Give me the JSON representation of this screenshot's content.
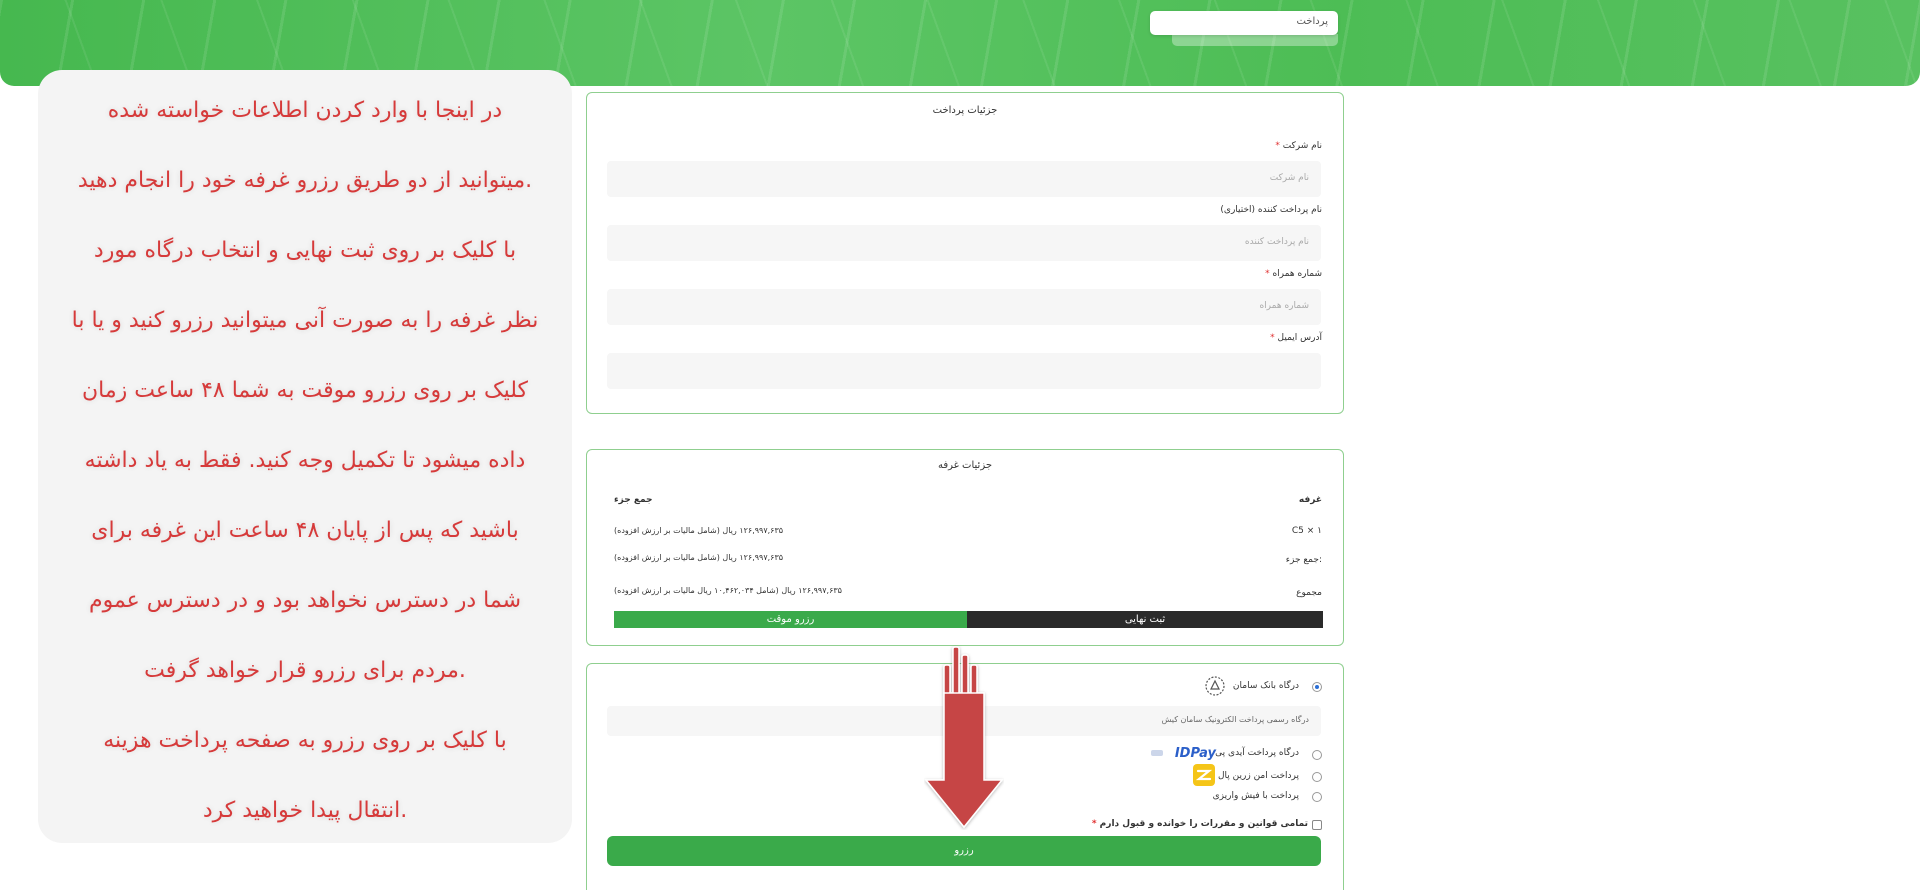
{
  "breadcrumb": {
    "label": "پرداخت"
  },
  "note": {
    "lines": [
      "در اینجا با وارد کردن اطلاعات خواسته شده",
      "میتوانید از دو طریق رزرو غرفه خود را انجام دهید.",
      "با کلیک بر روی ثبت نهایی و انتخاب درگاه مورد",
      "نظر غرفه را به صورت آنی میتوانید رزرو کنید و یا با",
      "کلیک بر روی رزرو موقت به شما ۴۸ ساعت زمان",
      "داده میشود تا تکمیل وجه کنید. فقط به یاد داشته",
      "باشید که پس از پایان ۴۸ ساعت این غرفه برای",
      "شما در دسترس نخواهد بود و در دسترس عموم",
      "مردم برای رزرو قرار خواهد گرفت.",
      "با کلیک بر روی رزرو به صفحه پرداخت هزینه",
      "انتقال پیدا خواهید کرد."
    ]
  },
  "payment_details": {
    "title": "جزئیات پرداخت",
    "company": {
      "label": "نام شرکت",
      "required": "*",
      "placeholder": "نام شرکت"
    },
    "payer": {
      "label": "نام پرداخت کننده (اختیاری)",
      "placeholder": "نام پرداخت کننده"
    },
    "mobile": {
      "label": "شماره همراه",
      "required": "*",
      "placeholder": "شماره همراه"
    },
    "email": {
      "label": "آدرس ایمیل",
      "required": "*",
      "placeholder": ""
    }
  },
  "booth_details": {
    "title": "جزئیات غرفه",
    "col_booth": "غرفه",
    "col_subtotal": "جمع جزء",
    "booth_value": "C5 × ۱",
    "booth_price": "۱۲۶,۹۹۷,۶۳۵ ریال (شامل مالیات بر ارزش افزوده)",
    "subtotal_label": "جمع جزء:",
    "subtotal_price": "۱۲۶,۹۹۷,۶۳۵ ریال (شامل مالیات بر ارزش افزوده)",
    "total_label": "مجموع",
    "total_price": "۱۲۶,۹۹۷,۶۳۵ ریال (شامل ۱۰,۴۶۲,۰۳۴ ریال مالیات بر ارزش افزوده)",
    "temp_button": "رزرو موقت",
    "final_button": "ثبت نهایی"
  },
  "gateways": {
    "saman": {
      "label": "درگاه بانک سامان",
      "description": "درگاه رسمی پرداخت الکترونیک سامان کیش"
    },
    "idpay": {
      "label": "درگاه پرداخت آیدی پی",
      "logo": "IDPay"
    },
    "zarinpal": {
      "label": "پرداخت امن زرین پال"
    },
    "receipt": {
      "label": "پرداخت با فیش واریزی"
    },
    "terms": {
      "label": "تمامی قوانین و مقررات را خوانده و قبول دارم",
      "required": "*"
    },
    "submit_label": "رزرو"
  },
  "colors": {
    "accent": "#3aaa4a",
    "note_text": "#d63a3a",
    "arrow": "#c64444"
  }
}
